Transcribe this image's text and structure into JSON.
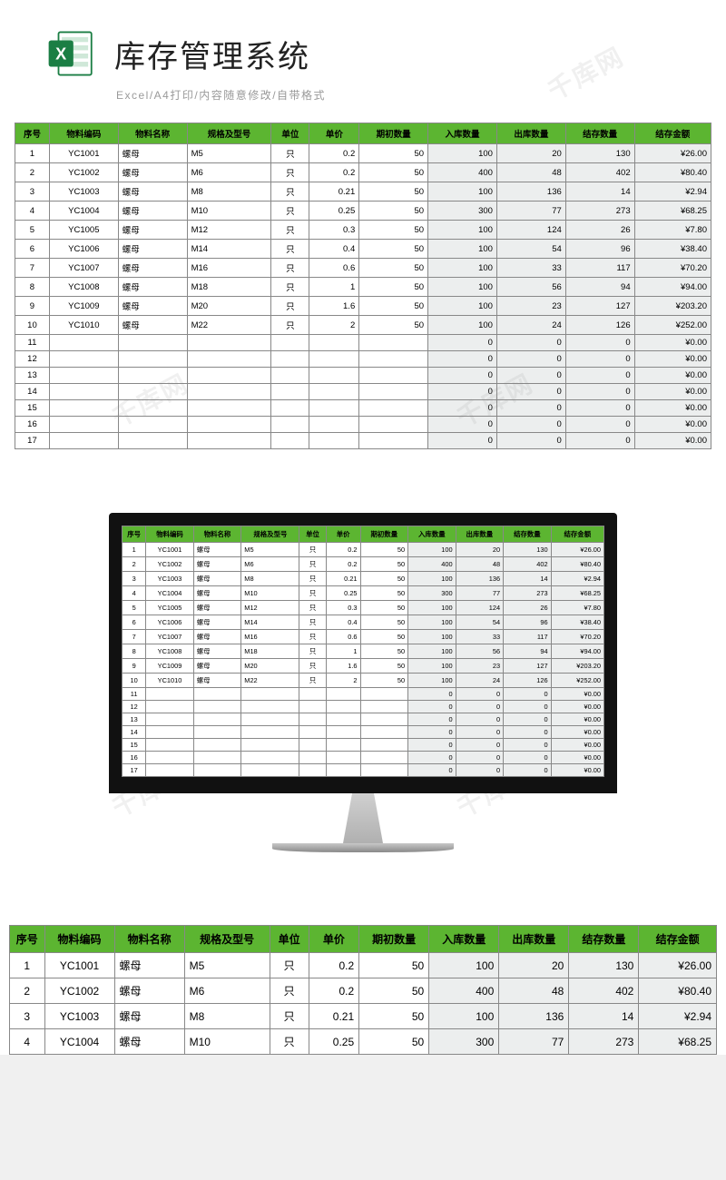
{
  "header": {
    "title": "库存管理系统",
    "subtitle": "Excel/A4打印/内容随意修改/自带格式"
  },
  "columns": {
    "seq": "序号",
    "code": "物料编码",
    "name": "物料名称",
    "spec": "规格及型号",
    "unit": "单位",
    "price": "单价",
    "begin_qty": "期初数量",
    "in_qty": "入库数量",
    "out_qty": "出库数量",
    "end_qty": "结存数量",
    "end_amt": "结存金额"
  },
  "rows": [
    {
      "seq": "1",
      "code": "YC1001",
      "name": "螺母",
      "spec": "M5",
      "unit": "只",
      "price": "0.2",
      "begin": "50",
      "in": "100",
      "out": "20",
      "end": "130",
      "amt": "¥26.00"
    },
    {
      "seq": "2",
      "code": "YC1002",
      "name": "螺母",
      "spec": "M6",
      "unit": "只",
      "price": "0.2",
      "begin": "50",
      "in": "400",
      "out": "48",
      "end": "402",
      "amt": "¥80.40"
    },
    {
      "seq": "3",
      "code": "YC1003",
      "name": "螺母",
      "spec": "M8",
      "unit": "只",
      "price": "0.21",
      "begin": "50",
      "in": "100",
      "out": "136",
      "end": "14",
      "amt": "¥2.94"
    },
    {
      "seq": "4",
      "code": "YC1004",
      "name": "螺母",
      "spec": "M10",
      "unit": "只",
      "price": "0.25",
      "begin": "50",
      "in": "300",
      "out": "77",
      "end": "273",
      "amt": "¥68.25"
    },
    {
      "seq": "5",
      "code": "YC1005",
      "name": "螺母",
      "spec": "M12",
      "unit": "只",
      "price": "0.3",
      "begin": "50",
      "in": "100",
      "out": "124",
      "end": "26",
      "amt": "¥7.80"
    },
    {
      "seq": "6",
      "code": "YC1006",
      "name": "螺母",
      "spec": "M14",
      "unit": "只",
      "price": "0.4",
      "begin": "50",
      "in": "100",
      "out": "54",
      "end": "96",
      "amt": "¥38.40"
    },
    {
      "seq": "7",
      "code": "YC1007",
      "name": "螺母",
      "spec": "M16",
      "unit": "只",
      "price": "0.6",
      "begin": "50",
      "in": "100",
      "out": "33",
      "end": "117",
      "amt": "¥70.20"
    },
    {
      "seq": "8",
      "code": "YC1008",
      "name": "螺母",
      "spec": "M18",
      "unit": "只",
      "price": "1",
      "begin": "50",
      "in": "100",
      "out": "56",
      "end": "94",
      "amt": "¥94.00"
    },
    {
      "seq": "9",
      "code": "YC1009",
      "name": "螺母",
      "spec": "M20",
      "unit": "只",
      "price": "1.6",
      "begin": "50",
      "in": "100",
      "out": "23",
      "end": "127",
      "amt": "¥203.20"
    },
    {
      "seq": "10",
      "code": "YC1010",
      "name": "螺母",
      "spec": "M22",
      "unit": "只",
      "price": "2",
      "begin": "50",
      "in": "100",
      "out": "24",
      "end": "126",
      "amt": "¥252.00"
    },
    {
      "seq": "11",
      "code": "",
      "name": "",
      "spec": "",
      "unit": "",
      "price": "",
      "begin": "",
      "in": "0",
      "out": "0",
      "end": "0",
      "amt": "¥0.00"
    },
    {
      "seq": "12",
      "code": "",
      "name": "",
      "spec": "",
      "unit": "",
      "price": "",
      "begin": "",
      "in": "0",
      "out": "0",
      "end": "0",
      "amt": "¥0.00"
    },
    {
      "seq": "13",
      "code": "",
      "name": "",
      "spec": "",
      "unit": "",
      "price": "",
      "begin": "",
      "in": "0",
      "out": "0",
      "end": "0",
      "amt": "¥0.00"
    },
    {
      "seq": "14",
      "code": "",
      "name": "",
      "spec": "",
      "unit": "",
      "price": "",
      "begin": "",
      "in": "0",
      "out": "0",
      "end": "0",
      "amt": "¥0.00"
    },
    {
      "seq": "15",
      "code": "",
      "name": "",
      "spec": "",
      "unit": "",
      "price": "",
      "begin": "",
      "in": "0",
      "out": "0",
      "end": "0",
      "amt": "¥0.00"
    },
    {
      "seq": "16",
      "code": "",
      "name": "",
      "spec": "",
      "unit": "",
      "price": "",
      "begin": "",
      "in": "0",
      "out": "0",
      "end": "0",
      "amt": "¥0.00"
    },
    {
      "seq": "17",
      "code": "",
      "name": "",
      "spec": "",
      "unit": "",
      "price": "",
      "begin": "",
      "in": "0",
      "out": "0",
      "end": "0",
      "amt": "¥0.00"
    }
  ],
  "bottom_rows_count": 4,
  "watermark": "千库网"
}
